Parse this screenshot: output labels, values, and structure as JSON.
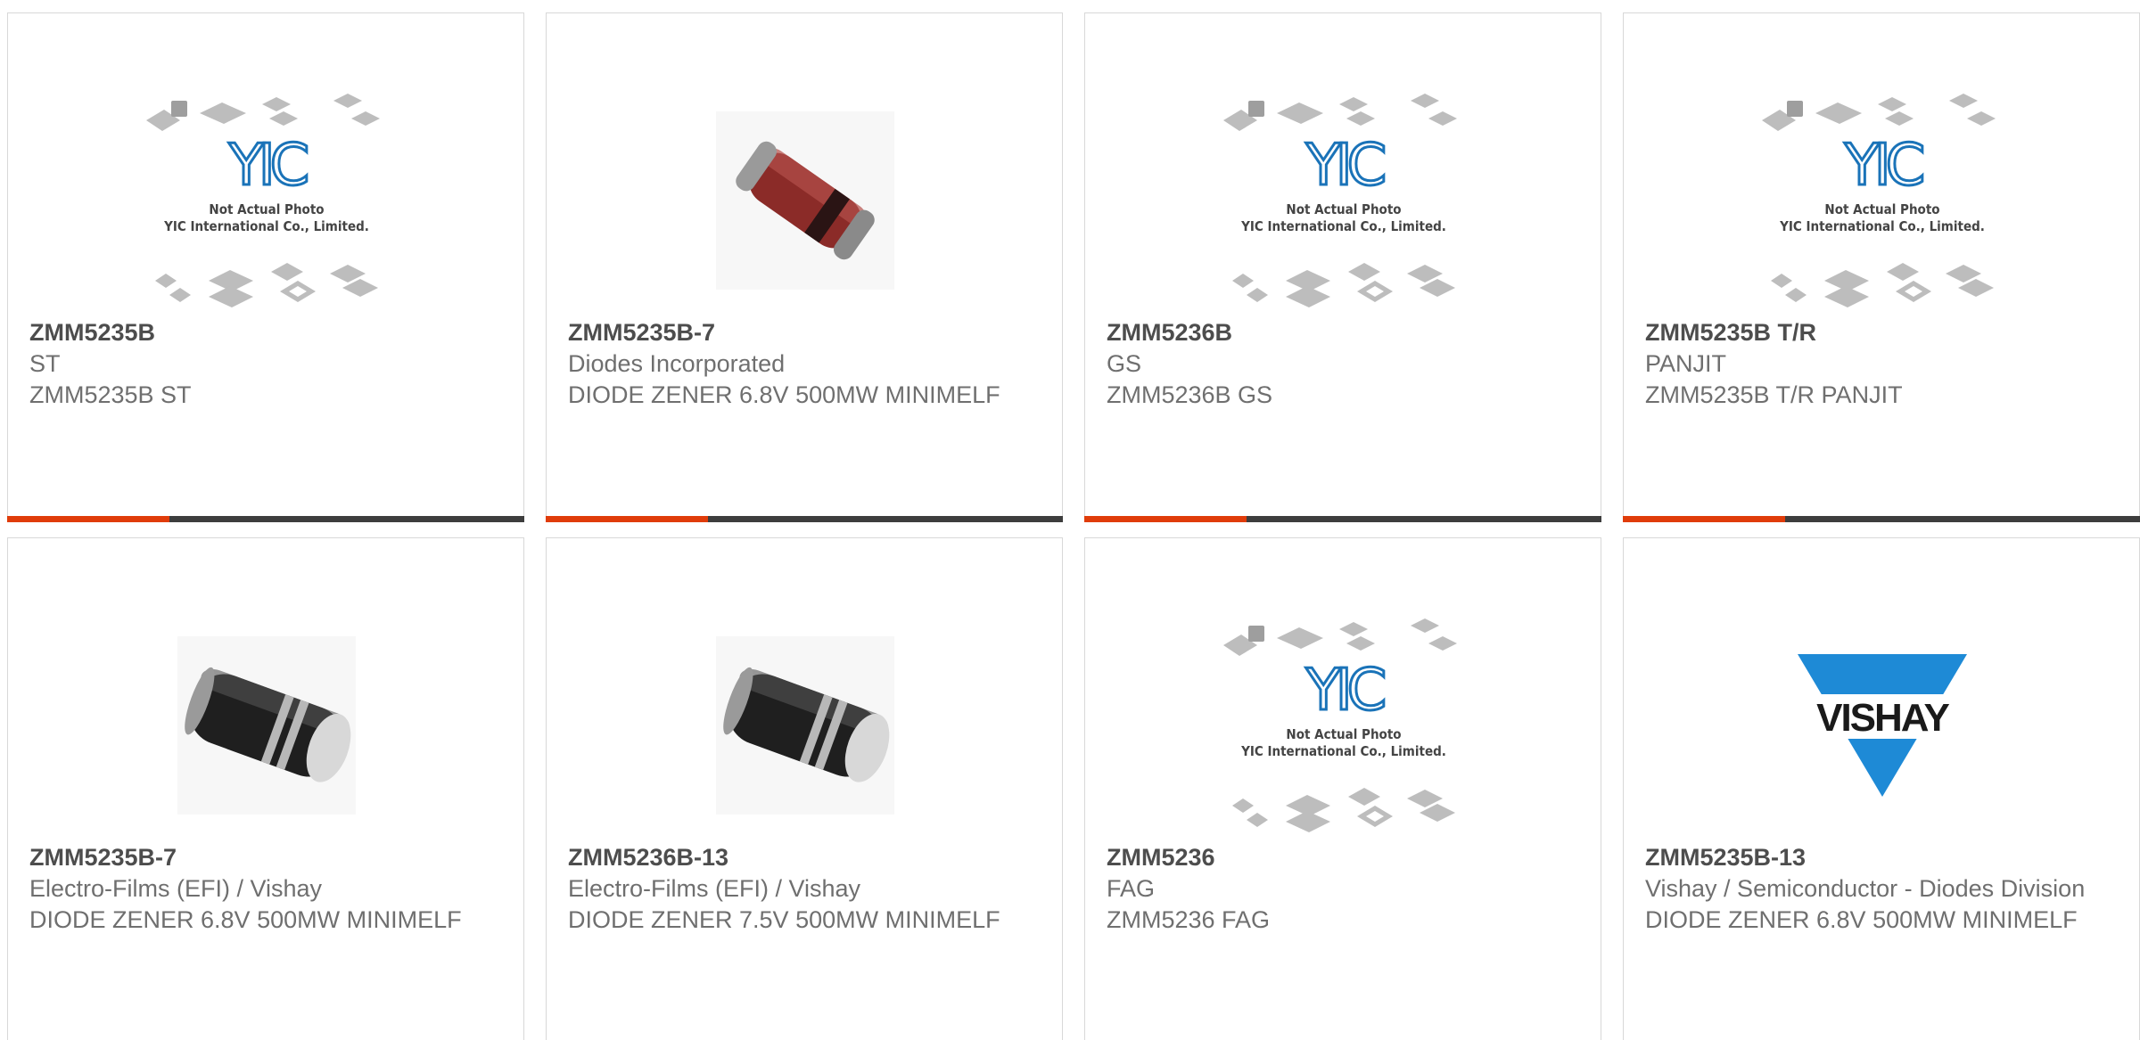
{
  "products": [
    {
      "part_number": "ZMM5235B",
      "manufacturer": "ST",
      "description": "ZMM5235B ST",
      "image": "yic-placeholder-icon"
    },
    {
      "part_number": "ZMM5235B-7",
      "manufacturer": "Diodes Incorporated",
      "description": "DIODE ZENER 6.8V 500MW MINIMELF",
      "image": "red-minimelf-diode-icon"
    },
    {
      "part_number": "ZMM5236B",
      "manufacturer": "GS",
      "description": "ZMM5236B GS",
      "image": "yic-placeholder-icon"
    },
    {
      "part_number": "ZMM5235B T/R",
      "manufacturer": "PANJIT",
      "description": "ZMM5235B T/R PANJIT",
      "image": "yic-placeholder-icon"
    },
    {
      "part_number": "ZMM5235B-7",
      "manufacturer": "Electro-Films (EFI) / Vishay",
      "description": "DIODE ZENER 6.8V 500MW MINIMELF",
      "image": "black-minimelf-diode-icon"
    },
    {
      "part_number": "ZMM5236B-13",
      "manufacturer": "Electro-Films (EFI) / Vishay",
      "description": "DIODE ZENER 7.5V 500MW MINIMELF",
      "image": "black-minimelf-diode-icon"
    },
    {
      "part_number": "ZMM5236",
      "manufacturer": "FAG",
      "description": "ZMM5236 FAG",
      "image": "yic-placeholder-icon"
    },
    {
      "part_number": "ZMM5235B-13",
      "manufacturer": "Vishay / Semiconductor - Diodes Division",
      "description": "DIODE ZENER 6.8V 500MW MINIMELF",
      "image": "vishay-logo-icon"
    }
  ],
  "placeholder": {
    "logo_text": "YIC",
    "line1": "Not Actual Photo",
    "line2": "YIC International Co., Limited."
  },
  "vishay_logo_text": "VISHAY",
  "colors": {
    "accent": "#e03c0a",
    "bar": "#3d3d3d",
    "vishay_blue": "#1e8ad6",
    "yic_blue": "#1a73b8"
  }
}
